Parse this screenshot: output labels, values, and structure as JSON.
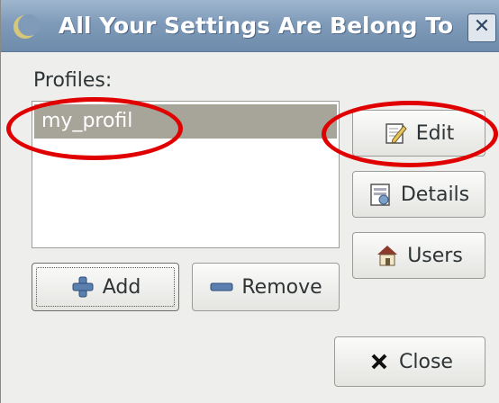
{
  "window": {
    "title": "All Your Settings Are Belong To"
  },
  "profiles": {
    "label": "Profiles:",
    "items": [
      "my_profil"
    ]
  },
  "buttons": {
    "edit": "Edit",
    "details": "Details",
    "users": "Users",
    "add": "Add",
    "remove": "Remove",
    "close": "Close"
  },
  "colors": {
    "titlebar": "#7f9bb9",
    "selected_row": "#a7a59a",
    "annotation": "#e00000"
  },
  "icons": {
    "title": "gnome-foot-icon",
    "close": "close-icon",
    "edit": "edit-pencil-icon",
    "details": "details-icon",
    "users": "users-house-icon",
    "add": "plus-icon",
    "remove": "minus-icon",
    "close_button": "x-icon"
  }
}
